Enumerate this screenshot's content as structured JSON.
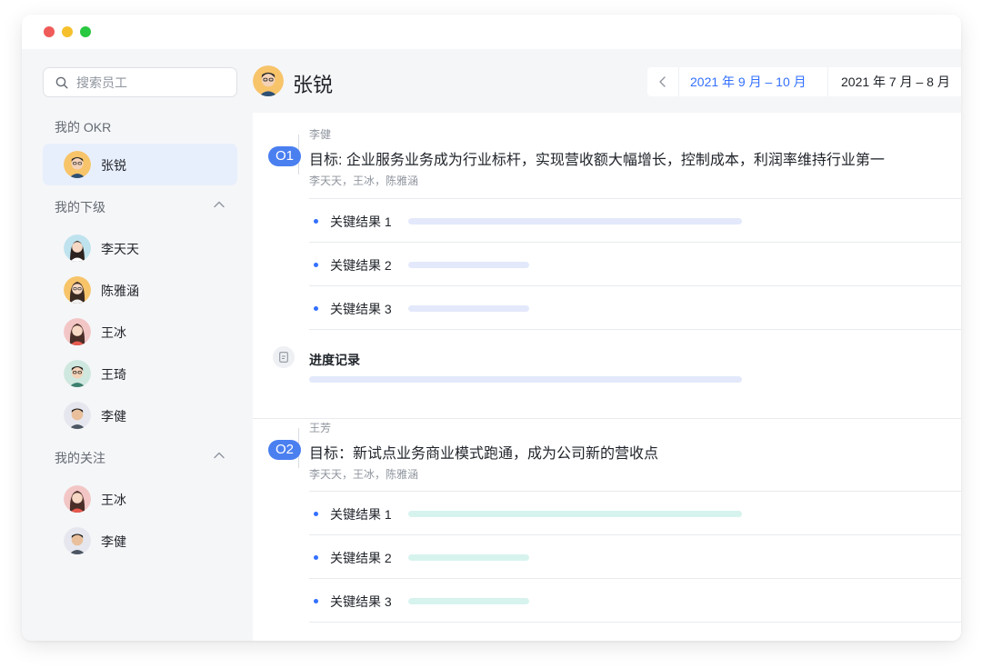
{
  "window": {
    "controls": [
      "close",
      "minimize",
      "maximize"
    ]
  },
  "search": {
    "placeholder": "搜索员工",
    "icon": "search-icon"
  },
  "sidebar": {
    "my_okr": {
      "label": "我的 OKR",
      "items": [
        {
          "name": "张锐",
          "active": true
        }
      ]
    },
    "subordinates": {
      "label": "我的下级",
      "collapse_icon": "chevron-up-icon",
      "items": [
        {
          "name": "李天天"
        },
        {
          "name": "陈雅涵"
        },
        {
          "name": "王冰"
        },
        {
          "name": "王琦"
        },
        {
          "name": "李健"
        }
      ]
    },
    "following": {
      "label": "我的关注",
      "collapse_icon": "chevron-up-icon",
      "items": [
        {
          "name": "王冰"
        },
        {
          "name": "李健"
        }
      ]
    }
  },
  "header": {
    "name": "张锐",
    "prev_icon": "chevron-left-icon",
    "ranges": [
      {
        "label": "2021 年 9 月 – 10 月",
        "active": true
      },
      {
        "label": "2021 年 7 月 – 8 月",
        "active": false
      }
    ]
  },
  "objectives": [
    {
      "badge": "O1",
      "owner": "李健",
      "title": "目标: 企业服务业务成为行业标杆，实现营收额大幅增长，控制成本，利润率维持行业第一",
      "collaborators": "李天天，王冰，陈雅涵",
      "key_results": [
        {
          "label": "关键结果 1",
          "progress": 0.77
        },
        {
          "label": "关键结果 2",
          "progress": 0.28
        },
        {
          "label": "关键结果 3",
          "progress": 0.28
        }
      ],
      "progress_record": {
        "label": "进度记录",
        "progress": 1.0
      }
    },
    {
      "badge": "O2",
      "owner": "王芳",
      "title": "目标：新试点业务商业模式跑通，成为公司新的营收点",
      "collaborators": "李天天，王冰，陈雅涵",
      "key_results": [
        {
          "label": "关键结果 1",
          "progress": 0.77
        },
        {
          "label": "关键结果 2",
          "progress": 0.28
        },
        {
          "label": "关键结果 3",
          "progress": 0.28
        }
      ]
    }
  ],
  "colors": {
    "accent": "#3370ff",
    "badge": "#4a7ff0",
    "o1_bar": "#e3e9fb",
    "o2_bar": "#d7f3ee",
    "active_row": "#e8effc"
  }
}
